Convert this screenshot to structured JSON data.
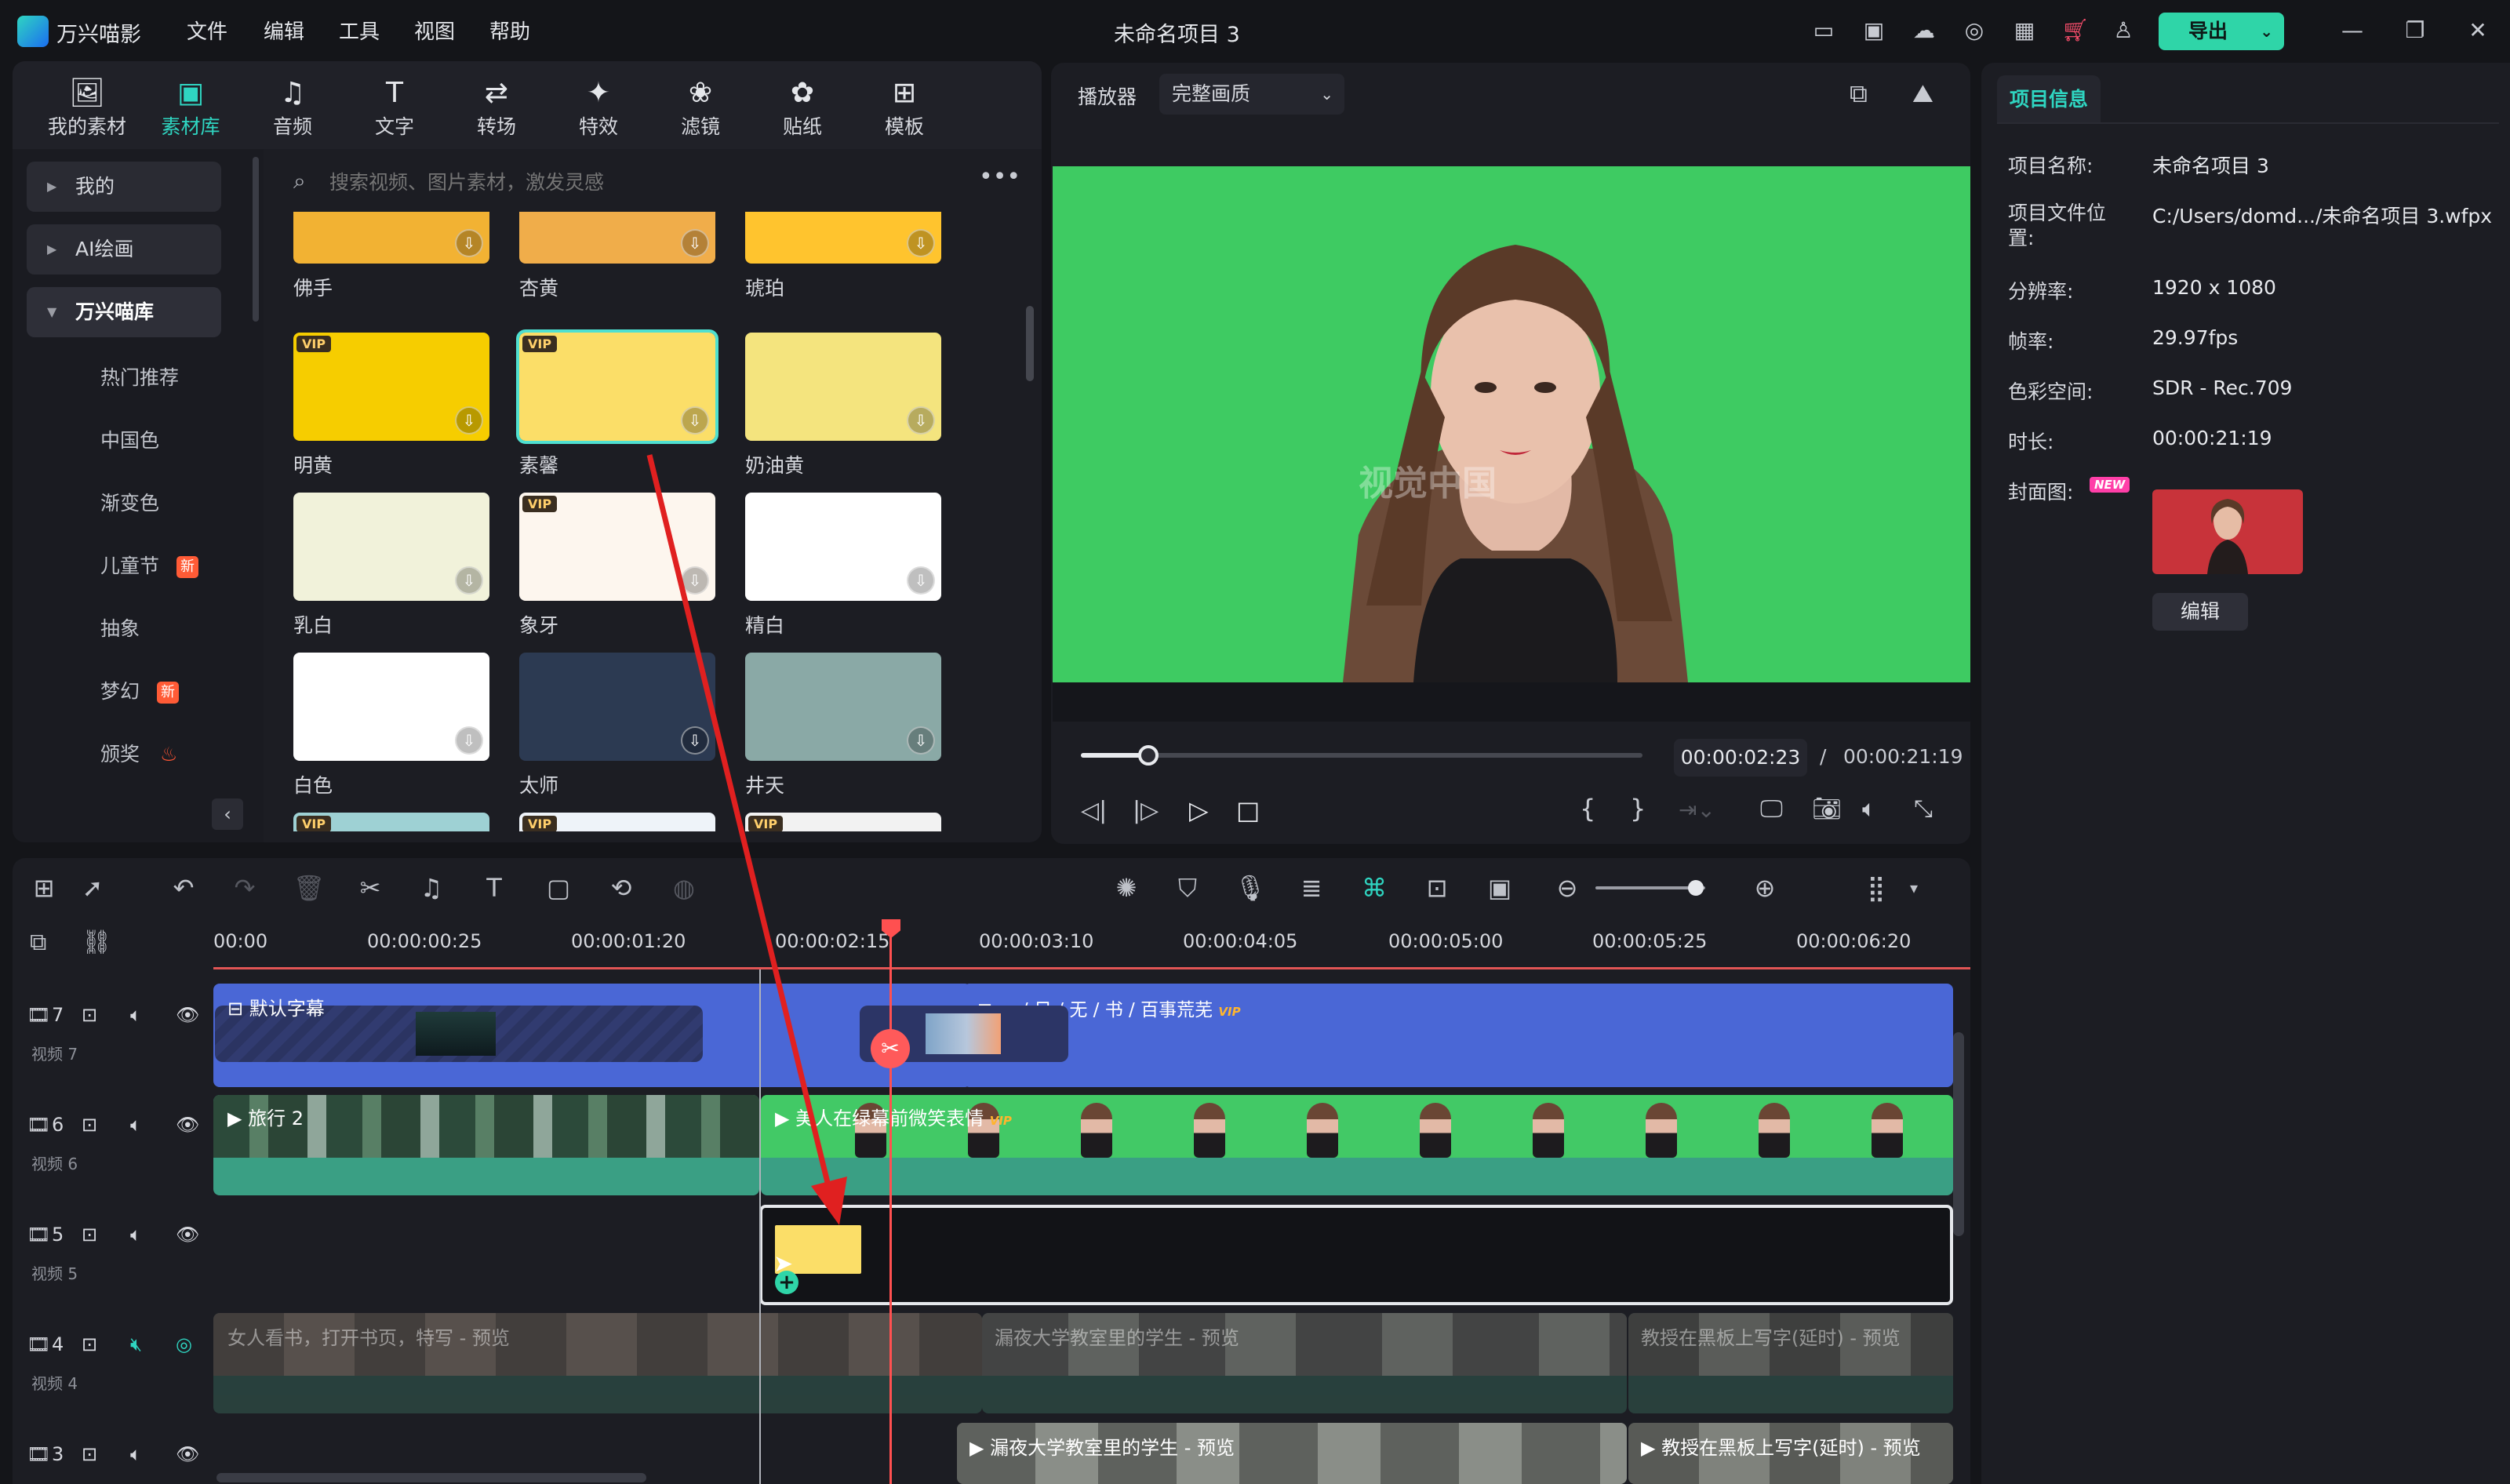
{
  "app": {
    "name": "万兴喵影",
    "project_title": "未命名项目 3",
    "export_label": "导出"
  },
  "menu": [
    "文件",
    "编辑",
    "工具",
    "视图",
    "帮助"
  ],
  "media_tabs": [
    {
      "label": "我的素材",
      "icon": "my-media-icon"
    },
    {
      "label": "素材库",
      "icon": "library-icon",
      "active": true
    },
    {
      "label": "音频",
      "icon": "music-note-icon"
    },
    {
      "label": "文字",
      "icon": "text-t-icon"
    },
    {
      "label": "转场",
      "icon": "transition-icon"
    },
    {
      "label": "特效",
      "icon": "effects-sparkle-icon"
    },
    {
      "label": "滤镜",
      "icon": "filter-icon"
    },
    {
      "label": "贴纸",
      "icon": "sticker-icon"
    },
    {
      "label": "模板",
      "icon": "template-icon"
    }
  ],
  "categories": {
    "mine": "我的",
    "ai_paint": "AI绘画",
    "wanxing": "万兴喵库",
    "sub": [
      {
        "label": "热门推荐",
        "new": false
      },
      {
        "label": "中国色",
        "new": false
      },
      {
        "label": "渐变色",
        "new": false
      },
      {
        "label": "儿童节",
        "new": true
      },
      {
        "label": "抽象",
        "new": false
      },
      {
        "label": "梦幻",
        "new": true
      },
      {
        "label": "颁奖",
        "new": false
      }
    ],
    "new_badge": "新"
  },
  "search": {
    "placeholder": "搜索视频、图片素材，激发灵感"
  },
  "swatches": [
    {
      "label": "佛手",
      "color": "#f2b233",
      "vip": false
    },
    {
      "label": "杏黄",
      "color": "#f0ad4a",
      "vip": false
    },
    {
      "label": "琥珀",
      "color": "#ffc42e",
      "vip": false
    },
    {
      "label": "明黄",
      "color": "#f6cd00",
      "vip": true
    },
    {
      "label": "素馨",
      "color": "#fbde68",
      "vip": true,
      "selected": true
    },
    {
      "label": "奶油黄",
      "color": "#f4e47e",
      "vip": false
    },
    {
      "label": "乳白",
      "color": "#f1f2da",
      "vip": false
    },
    {
      "label": "象牙",
      "color": "#fdf6ee",
      "vip": true
    },
    {
      "label": "精白",
      "color": "#ffffff",
      "vip": false
    },
    {
      "label": "白色",
      "color": "#ffffff",
      "vip": false
    },
    {
      "label": "太师",
      "color": "#2c3a52",
      "vip": false
    },
    {
      "label": "井天",
      "color": "#8aa9a6",
      "vip": false
    }
  ],
  "vip_label": "VIP",
  "player": {
    "label": "播放器",
    "quality": "完整画质",
    "current_time": "00:00:02:23",
    "separator": "/",
    "total_time": "00:00:21:19",
    "progress": 0.12,
    "watermark": "视觉中国"
  },
  "project_info": {
    "tab": "项目信息",
    "rows": [
      {
        "k": "项目名称:",
        "v": "未命名项目 3"
      },
      {
        "k": "项目文件位置:",
        "v": "C:/Users/domd.../未命名项目 3.wfpx"
      },
      {
        "k": "分辨率:",
        "v": "1920 x 1080"
      },
      {
        "k": "帧率:",
        "v": "29.97fps"
      },
      {
        "k": "色彩空间:",
        "v": "SDR - Rec.709"
      },
      {
        "k": "时长:",
        "v": "00:00:21:19"
      }
    ],
    "cover_label": "封面图:",
    "new_badge": "NEW",
    "edit_label": "编辑"
  },
  "timeline": {
    "ruler": [
      "00:00",
      "00:00:00:25",
      "00:00:01:20",
      "00:00:02:15",
      "00:00:03:10",
      "00:00:04:05",
      "00:00:05:00",
      "00:00:05:25",
      "00:00:06:20"
    ],
    "tracks": [
      {
        "num": "7",
        "name": "视频 7"
      },
      {
        "num": "6",
        "name": "视频 6"
      },
      {
        "num": "5",
        "name": "视频 5"
      },
      {
        "num": "4",
        "name": "视频 4"
      },
      {
        "num": "3",
        "name": ""
      }
    ],
    "clips": {
      "t7a": "默认字幕",
      "t7b": "一 / 日 / 无 / 书 / 百事荒芜",
      "t6a": "旅行 2",
      "t6b": "美人在绿幕前微笑表情",
      "t4a": "女人看书，打开书页，特写 - 预览",
      "t4b": "漏夜大学教室里的学生 - 预览",
      "t4c": "教授在黑板上写字(延时) - 预览",
      "t3a": "漏夜大学教室里的学生 - 预览",
      "t3b": "教授在黑板上写字(延时) - 预览"
    },
    "vip_small": "VIP"
  },
  "colors": {
    "accent": "#2fd5c1",
    "playhead": "#ff5050",
    "arrow": "#e02020",
    "track_blue": "#4a67d6",
    "track_green": "#3a9f84"
  }
}
